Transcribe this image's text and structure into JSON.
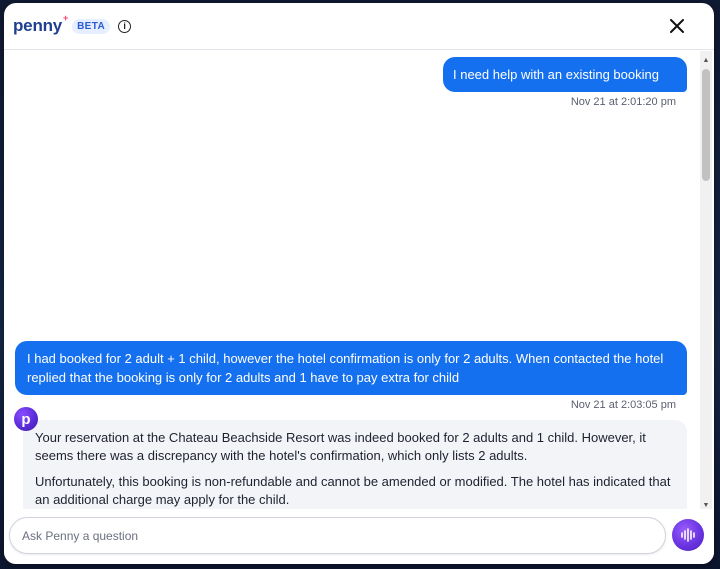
{
  "header": {
    "logo_text": "penny",
    "logo_spark": "+",
    "beta_label": "BETA",
    "info_icon": "i",
    "close_icon": "close-icon"
  },
  "messages": {
    "user_1": {
      "text": "I need help with an existing booking",
      "timestamp": "Nov 21 at 2:01:20 pm"
    },
    "user_2": {
      "text": "I had booked for 2 adult + 1 child, however the hotel confirmation is only for 2 adults. When contacted the hotel replied that the booking is only for 2 adults and 1 have to pay extra for child",
      "timestamp": "Nov 21 at 2:03:05 pm"
    },
    "bot_1": {
      "avatar_letter": "p",
      "paragraphs": [
        "Your reservation at the Chateau Beachside Resort was indeed booked for 2 adults and 1 child. However, it seems there was a discrepancy with the hotel's confirmation, which only lists 2 adults.",
        "Unfortunately, this booking is non-refundable and cannot be amended or modified. The hotel has indicated that an additional charge may apply for the child."
      ]
    }
  },
  "composer": {
    "placeholder": "Ask Penny a question",
    "value": "",
    "voice_icon": "voice-wave-icon"
  },
  "colors": {
    "user_bubble": "#1570ef",
    "bot_bubble": "#f2f4f7",
    "brand": "#1f3f8f",
    "accent_purple": "#6a34e0"
  }
}
